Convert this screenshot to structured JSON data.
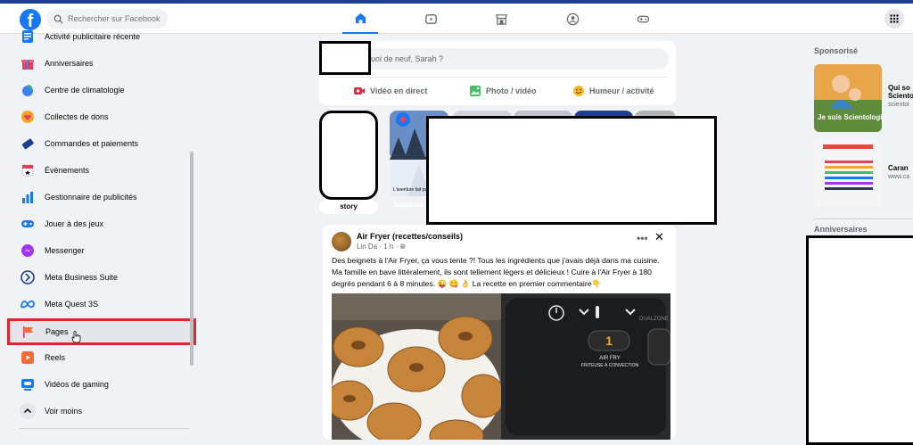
{
  "topbar": {
    "logo": "f",
    "search_placeholder": "Rechercher sur Facebook",
    "nav": [
      "home-icon",
      "video-icon",
      "marketplace-icon",
      "groups-icon",
      "gaming-icon"
    ]
  },
  "sidebar": {
    "items": [
      {
        "label": "Activité publicitaire récente",
        "icon": "ads-activity-icon"
      },
      {
        "label": "Anniversaires",
        "icon": "gift-icon"
      },
      {
        "label": "Centre de climatologie",
        "icon": "climate-icon"
      },
      {
        "label": "Collectes de dons",
        "icon": "heart-icon"
      },
      {
        "label": "Commandes et paiements",
        "icon": "payments-icon"
      },
      {
        "label": "Évènements",
        "icon": "calendar-icon"
      },
      {
        "label": "Gestionnaire de publicités",
        "icon": "bar-chart-icon"
      },
      {
        "label": "Jouer à des jeux",
        "icon": "gamepad-icon"
      },
      {
        "label": "Messenger",
        "icon": "messenger-icon"
      },
      {
        "label": "Meta Business Suite",
        "icon": "business-suite-icon"
      },
      {
        "label": "Meta Quest 3S",
        "icon": "meta-icon"
      },
      {
        "label": "Pages",
        "icon": "flag-icon"
      },
      {
        "label": "Reels",
        "icon": "reels-icon"
      },
      {
        "label": "Vidéos de gaming",
        "icon": "gaming-video-icon"
      },
      {
        "label": "Voir moins",
        "icon": "chevron-up-icon"
      }
    ]
  },
  "composer": {
    "placeholder": "uoi de neuf, Sarah ?",
    "actions": [
      "Vidéo en direct",
      "Photo / vidéo",
      "Humeur / activité"
    ]
  },
  "stories": [
    {
      "label": "story"
    },
    {
      "label": "lagrappe...",
      "overlay": "L'aventure fait partie de toi"
    }
  ],
  "post": {
    "title": "Air Fryer (recettes/conseils)",
    "meta": "Lin Da · 1 h ·",
    "text": "Des beignets à l'Air Fryer, ça vous tente ?! Tous les ingrédients que j'avais déjà dans ma cuisine. Ma famille en bave littéralement, ils sont tellement légers et délicieux ! Cuire à l'Air Fryer à 180 degrés pendant 6 à 8 minutes. 😜 😋 👌 La recette en premier commentaire👇",
    "image_labels": {
      "display": "1",
      "brand": "DUALZONE",
      "mode": "AIR FRY",
      "mode_fr": "FRITEUSE À CONVECTION"
    }
  },
  "right": {
    "sponsored": "Sponsorisé",
    "ads": [
      {
        "title": "Qui so",
        "line2": "Scientol",
        "domain": "scientol",
        "image_text": "Je suis Scientologiste"
      },
      {
        "title": "Caran",
        "domain": "www.ca"
      }
    ],
    "birthdays": "Anniversaires"
  },
  "colors": {
    "brand": "#1877f2",
    "highlight": "#e0262e",
    "bg": "#f0f2f5"
  }
}
